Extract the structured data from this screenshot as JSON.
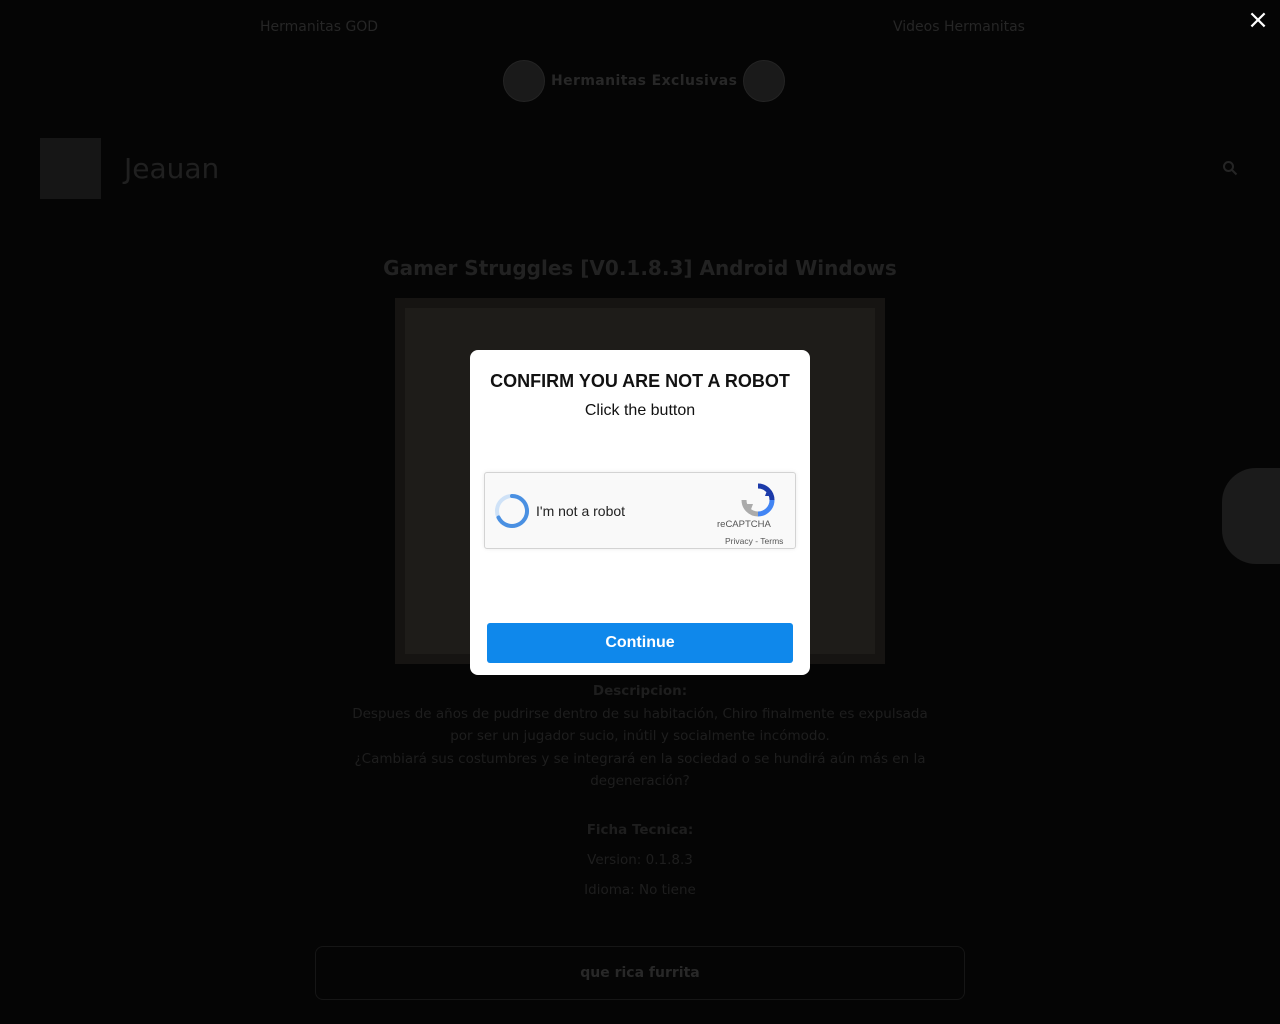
{
  "site": {
    "top_links": [
      "Hermanitas GOD",
      "Videos Hermanitas"
    ],
    "banner_text": "Hermanitas Exclusivas",
    "logo_text": "Jeauan",
    "post_title": "Gamer Struggles [V0.1.8.3] Android Windows",
    "description_heading": "Descripcion:",
    "description_lines": [
      "Despues de años de pudrirse dentro de su habitación, Chiro finalmente es expulsada",
      "por ser un jugador sucio, inútil y socialmente incómodo.",
      "¿Cambiará sus costumbres y se integrará en la sociedad o se hundirá aún más en la",
      "degeneración?"
    ],
    "ficha_heading": "Ficha Tecnica:",
    "ficha_lines": [
      "Version: 0.1.8.3",
      "Idioma: No tiene"
    ],
    "download_button": "que rica furrita"
  },
  "overlay": {
    "close_icon": "×"
  },
  "modal": {
    "title": "CONFIRM YOU ARE NOT A ROBOT",
    "subtitle": "Click the button",
    "captcha": {
      "label": "I'm not a robot",
      "brand": "reCAPTCHA",
      "links": "Privacy - Terms",
      "spinner_color": "#4a90e2"
    },
    "continue_label": "Continue",
    "accent": "#0f88eb"
  }
}
